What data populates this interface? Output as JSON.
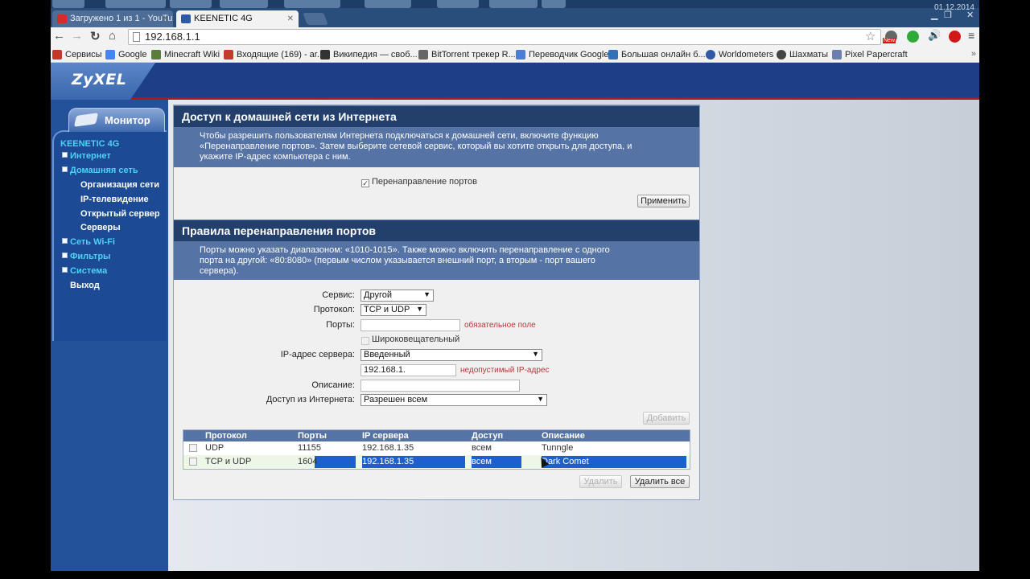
{
  "browser": {
    "datetime": "01.12.2014",
    "tabs": [
      {
        "title": "Загружено 1 из 1 - YouTu",
        "active": false,
        "favicon_color": "#d62b2b"
      },
      {
        "title": "KEENETIC 4G",
        "active": true,
        "favicon_color": "#2f5aa6"
      }
    ],
    "address": "192.168.1.1",
    "bookmarks": [
      {
        "label": "Сервисы",
        "icon_color": "#c0392b"
      },
      {
        "label": "Google",
        "icon_color": "#4285f4"
      },
      {
        "label": "Minecraft Wiki",
        "icon_color": "#5a7d3a"
      },
      {
        "label": "Входящие (169) - ar...",
        "icon_color": "#c23b2b"
      },
      {
        "label": "Википедия — своб...",
        "icon_color": "#333333"
      },
      {
        "label": "BitTorrent трекер R...",
        "icon_color": "#666666"
      },
      {
        "label": "Переводчик Google",
        "icon_color": "#4a7fd1"
      },
      {
        "label": "Большая онлайн б...",
        "icon_color": "#3470b5"
      },
      {
        "label": "Worldometers",
        "icon_color": "#2f5aa6"
      },
      {
        "label": "Шахматы",
        "icon_color": "#444444"
      },
      {
        "label": "Pixel Papercraft",
        "icon_color": "#6a7fb0"
      }
    ],
    "more_label": "»",
    "new_badge": "New"
  },
  "router": {
    "logo": "ZyXEL",
    "monitor_tab": "Монитор",
    "device": "KEENETIC 4G",
    "menu": [
      {
        "label": "Интернет",
        "type": "top",
        "expander": "plus"
      },
      {
        "label": "Домашняя сеть",
        "type": "top",
        "expander": "minus"
      },
      {
        "label": "Организация сети",
        "type": "sub"
      },
      {
        "label": "IP-телевидение",
        "type": "sub"
      },
      {
        "label": "Открытый сервер",
        "type": "sub"
      },
      {
        "label": "Серверы",
        "type": "sub"
      },
      {
        "label": "Сеть Wi-Fi",
        "type": "top",
        "expander": "plus"
      },
      {
        "label": "Фильтры",
        "type": "top",
        "expander": "plus"
      },
      {
        "label": "Система",
        "type": "top",
        "expander": "plus"
      },
      {
        "label": "Выход",
        "type": "plain"
      }
    ],
    "section1": {
      "title": "Доступ к домашней сети из Интернета",
      "desc_lines": [
        "Чтобы разрешить пользователям Интернета подключаться к домашней сети, включите функцию",
        "«Перенаправление портов». Затем выберите сетевой сервис, который вы хотите открыть для доступа, и",
        "укажите IP-адрес компьютера с ним."
      ],
      "checkbox_label": "Перенаправление портов",
      "checkbox_checked": true,
      "apply_button": "Применить"
    },
    "section2": {
      "title": "Правила перенаправления портов",
      "desc_lines": [
        "Порты можно указать диапазоном: «1010-1015». Также можно включить перенаправление с одного",
        "порта на другой: «80:8080» (первым числом указывается внешний порт, а вторым - порт вашего",
        "сервера)."
      ],
      "form": {
        "service_label": "Сервис:",
        "service_value": "Другой",
        "protocol_label": "Протокол:",
        "protocol_value": "TCP и UDP",
        "ports_label": "Порты:",
        "ports_value": "",
        "ports_error": "обязательное поле",
        "broadcast_label": "Широковещательный",
        "ip_label": "IP-адрес сервера:",
        "ip_mode_value": "Введенный",
        "ip_value": "192.168.1.",
        "ip_error": "недопустимый IP-адрес",
        "desc_label": "Описание:",
        "desc_value": "",
        "access_label": "Доступ из Интернета:",
        "access_value": "Разрешен всем",
        "add_button": "Добавить"
      },
      "table": {
        "headers": [
          "Протокол",
          "Порты",
          "IP сервера",
          "Доступ",
          "Описание"
        ],
        "rows": [
          {
            "protocol": "UDP",
            "ports": "11155",
            "ip": "192.168.1.35",
            "access": "всем",
            "description": "Tunngle"
          },
          {
            "protocol": "TCP и UDP",
            "ports": "1604",
            "ip": "192.168.1.35",
            "access": "всем",
            "description": "Dark Comet"
          }
        ]
      },
      "delete_button": "Удалить",
      "delete_all_button": "Удалить все"
    }
  }
}
